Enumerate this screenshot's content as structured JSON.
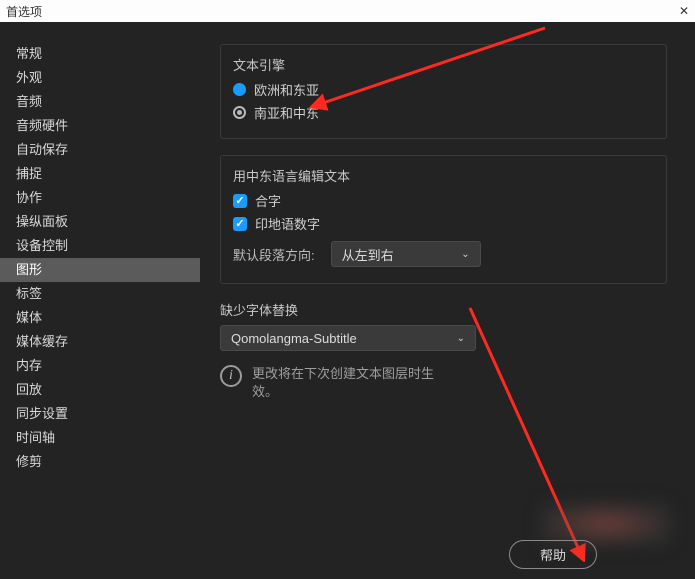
{
  "titlebar": {
    "title": "首选项",
    "close": "✕"
  },
  "sidebar": {
    "items": [
      "常规",
      "外观",
      "音频",
      "音频硬件",
      "自动保存",
      "捕捉",
      "协作",
      "操纵面板",
      "设备控制",
      "图形",
      "标签",
      "媒体",
      "媒体缓存",
      "内存",
      "回放",
      "同步设置",
      "时间轴",
      "修剪"
    ],
    "selectedIndex": 9
  },
  "main": {
    "textEngine": {
      "title": "文本引擎",
      "options": [
        "欧洲和东亚",
        "南亚和中东"
      ],
      "selectedIndex": 0
    },
    "rtlEditing": {
      "title": "用中东语言编辑文本",
      "checks": [
        "合字",
        "印地语数字"
      ],
      "paraDirLabel": "默认段落方向:",
      "paraDirValue": "从左到右"
    },
    "fontSub": {
      "title": "缺少字体替换",
      "value": "Qomolangma-Subtitle"
    },
    "info": "更改将在下次创建文本图层时生效。"
  },
  "footer": {
    "help": "帮助"
  },
  "colors": {
    "accent": "#1a9cff",
    "arrow": "#ff2a1f"
  }
}
